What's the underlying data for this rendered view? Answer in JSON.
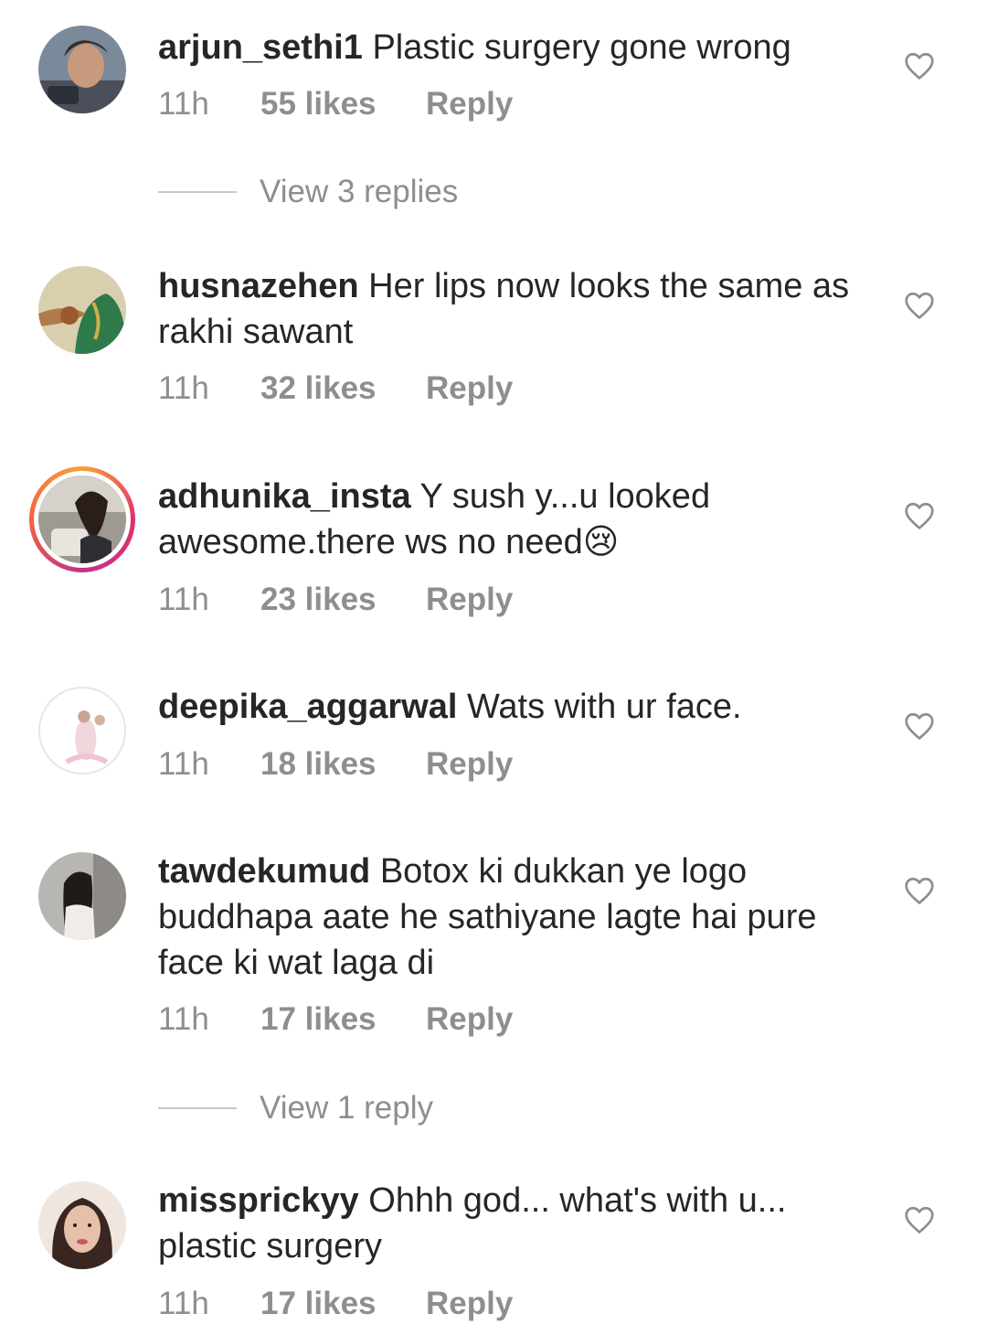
{
  "comments": [
    {
      "username": "arjun_sethi1",
      "text": "Plastic surgery gone wrong",
      "time": "11h",
      "likes": "55 likes",
      "reply": "Reply",
      "avatar": "avatar-photo",
      "view_replies": "View 3 replies"
    },
    {
      "username": "husnazehen",
      "text": "Her lips now looks the same as rakhi sawant",
      "time": "11h",
      "likes": "32 likes",
      "reply": "Reply",
      "avatar": "avatar-photo"
    },
    {
      "username": "adhunika_insta",
      "text": "Y sush y...u looked awesome.there ws no need😢",
      "time": "11h",
      "likes": "23 likes",
      "reply": "Reply",
      "avatar": "avatar-photo-story-ring"
    },
    {
      "username": "deepika_aggarwal",
      "text": "Wats with ur face.",
      "time": "11h",
      "likes": "18 likes",
      "reply": "Reply",
      "avatar": "avatar-photo"
    },
    {
      "username": "tawdekumud",
      "text": "Botox ki dukkan ye logo buddhapa aate he sathiyane lagte hai pure face ki wat laga di",
      "time": "11h",
      "likes": "17 likes",
      "reply": "Reply",
      "avatar": "avatar-photo",
      "view_replies": "View 1 reply"
    },
    {
      "username": "missprickyy",
      "text": "Ohhh god... what's with u... plastic surgery",
      "time": "11h",
      "likes": "17 likes",
      "reply": "Reply",
      "avatar": "avatar-photo"
    }
  ],
  "icons": {
    "like": "heart-outline-icon"
  },
  "colors": {
    "text": "#262626",
    "secondary": "#8e8e8e",
    "divider": "#c7c7c7",
    "story_ring_start": "#f9a13a",
    "story_ring_end": "#c13584"
  }
}
